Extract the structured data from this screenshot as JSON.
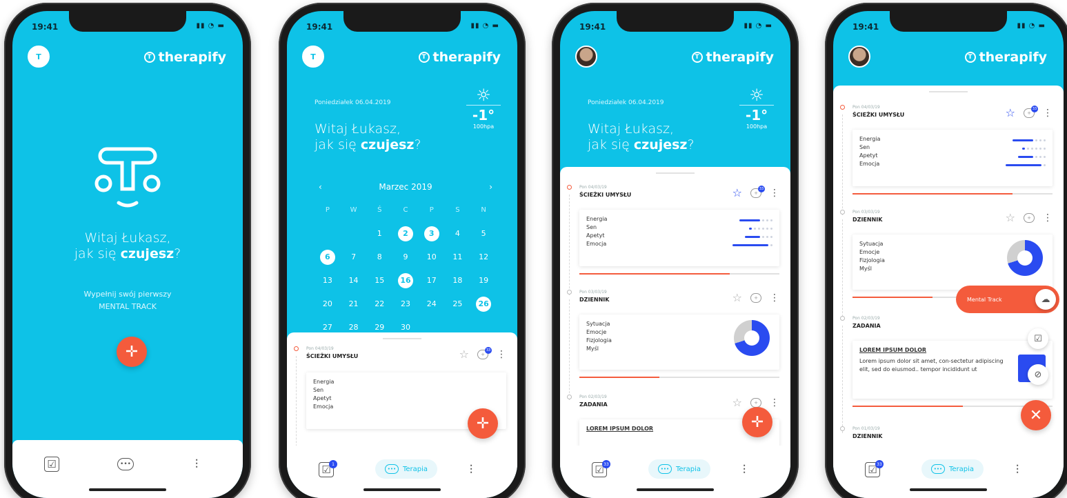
{
  "status": {
    "time": "19:41"
  },
  "brand": "therapify",
  "greeting": {
    "line1": "Witaj Łukasz,",
    "prefix": "jak się ",
    "bold": "czujesz",
    "suffix": "?"
  },
  "cta": {
    "line1": "Wypełnij swój pierwszy",
    "line2": "MENTAL TRACK"
  },
  "header": {
    "date": "Poniedziałek 06.04.2019",
    "temp": "-1°",
    "pressure": "100hpa"
  },
  "calendar": {
    "month": "Marzec 2019",
    "weekdays": [
      "P",
      "W",
      "Ś",
      "C",
      "P",
      "S",
      "N"
    ],
    "rows": [
      [
        "",
        "",
        "",
        "",
        "",
        "",
        ""
      ],
      [
        "",
        "",
        "1",
        "2",
        "3",
        "4",
        "5"
      ],
      [
        "6",
        "7",
        "8",
        "9",
        "10",
        "11",
        "12"
      ],
      [
        "13",
        "14",
        "15",
        "16",
        "17",
        "18",
        "19"
      ],
      [
        "20",
        "21",
        "22",
        "23",
        "24",
        "25",
        "26"
      ],
      [
        "27",
        "28",
        "29",
        "30",
        "",
        "",
        ""
      ]
    ],
    "selected": [
      "2",
      "3",
      "6",
      "16",
      "26"
    ]
  },
  "entries": {
    "e1": {
      "date": "Pon 04/03/19",
      "title": "ŚCIEŻKI UMYSŁU",
      "badge": "33",
      "rows": [
        "Energia",
        "Sen",
        "Apetyt",
        "Emocja"
      ]
    },
    "e2": {
      "date": "Pon 03/03/19",
      "title": "DZIENNIK",
      "rows": [
        "Sytuacja",
        "Emocje",
        "Fizjologia",
        "Myśl"
      ]
    },
    "e3": {
      "date": "Pon 02/03/19",
      "title": "ZADANIA",
      "lorem_title": "LOREM IPSUM DOLOR",
      "lorem_text": "Lorem ipsum dolor sit amet, con-sectetur adipiscing elit, sed do eiusmod.. tempor incididunt ut"
    },
    "e4": {
      "date": "Pon 01/03/19",
      "title": "DZIENNIK"
    }
  },
  "tabs": {
    "therapy": "Terapia",
    "badge1": "1",
    "badge33": "33"
  },
  "fab_menu": {
    "mental": "Mental Track"
  }
}
